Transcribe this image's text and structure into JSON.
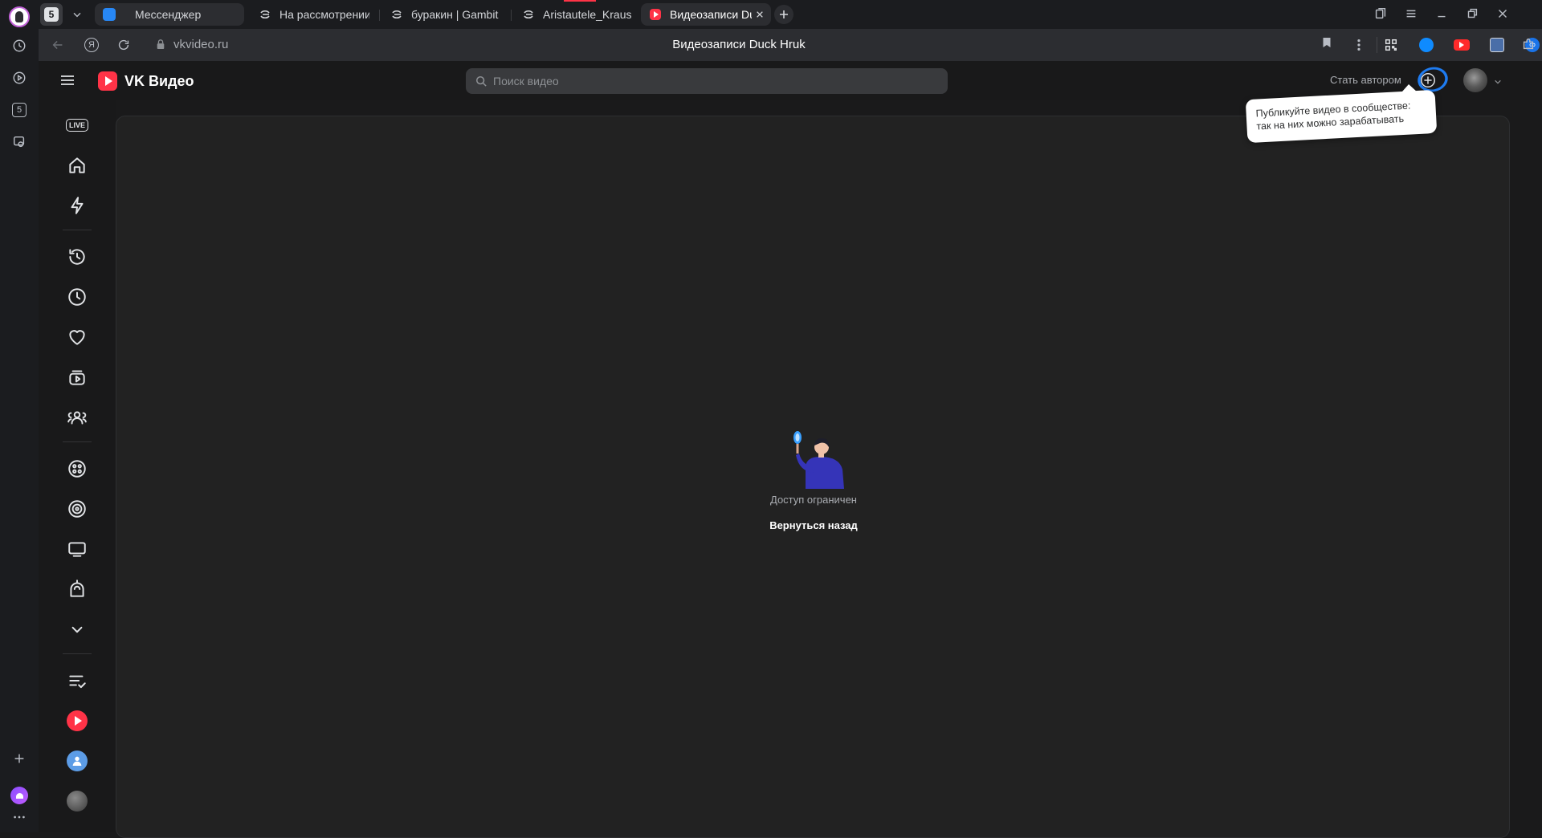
{
  "browser": {
    "tabs": [
      {
        "label": "Мессенджер",
        "icon": "messenger-icon"
      },
      {
        "label": "На рассмотрении - Mozen",
        "icon": "gambit-icon"
      },
      {
        "label": "буракин | Gambit Role Play",
        "icon": "gambit-icon"
      },
      {
        "label": "Aristautele_Krause | Gambit",
        "icon": "gambit-icon"
      },
      {
        "label": "Видеозаписи Duck Hruk",
        "icon": "vk-video-icon"
      }
    ],
    "tab_counter": "5",
    "address": "vkvideo.ru",
    "page_title": "Видеозаписи Duck Hruk"
  },
  "vk": {
    "logo_text": "VK Видео",
    "search_placeholder": "Поиск видео",
    "become_author": "Стать автором",
    "tooltip": "Публикуйте видео в сообществе: так на них можно зарабатывать",
    "live_badge": "LIVE"
  },
  "content": {
    "message": "Доступ ограничен",
    "back_button": "Вернуться назад"
  },
  "colors": {
    "accent_red": "#ff3347",
    "accent_blue": "#2787f5",
    "circle_highlight": "#1e7bf0"
  }
}
